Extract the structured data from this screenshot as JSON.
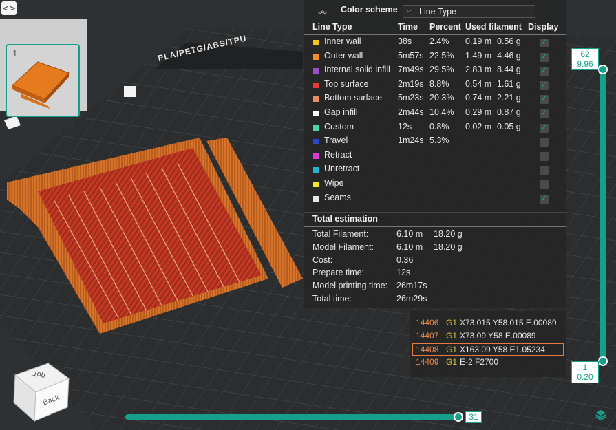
{
  "toolbar": {
    "toggle_icon": "<>"
  },
  "plate": {
    "number": "1",
    "bed_label": "PLA/PETG/ABS/TPU"
  },
  "view_cube": {
    "top": "Top",
    "back": "Back"
  },
  "color_scheme": {
    "label": "Color scheme",
    "value": "Line Type"
  },
  "table": {
    "headers": {
      "line_type": "Line Type",
      "time": "Time",
      "percent": "Percent",
      "used_filament": "Used filament",
      "display": "Display"
    },
    "rows": [
      {
        "name": "Inner wall",
        "color": "#f5c518",
        "time": "38s",
        "percent": "2.4%",
        "length": "0.19 m",
        "weight": "0.56 g",
        "display": true
      },
      {
        "name": "Outer wall",
        "color": "#f58c2a",
        "time": "5m57s",
        "percent": "22.5%",
        "length": "1.49 m",
        "weight": "4.46 g",
        "display": true
      },
      {
        "name": "Internal solid infill",
        "color": "#9a4fd0",
        "time": "7m49s",
        "percent": "29.5%",
        "length": "2.83 m",
        "weight": "8.44 g",
        "display": true
      },
      {
        "name": "Top surface",
        "color": "#e8393a",
        "time": "2m19s",
        "percent": "8.8%",
        "length": "0.54 m",
        "weight": "1.61 g",
        "display": true
      },
      {
        "name": "Bottom surface",
        "color": "#f08a60",
        "time": "5m23s",
        "percent": "20.3%",
        "length": "0.74 m",
        "weight": "2.21 g",
        "display": true
      },
      {
        "name": "Gap infill",
        "color": "#ffffff",
        "time": "2m44s",
        "percent": "10.4%",
        "length": "0.29 m",
        "weight": "0.87 g",
        "display": true
      },
      {
        "name": "Custom",
        "color": "#4cd4a0",
        "time": "12s",
        "percent": "0.8%",
        "length": "0.02 m",
        "weight": "0.05 g",
        "display": true
      },
      {
        "name": "Travel",
        "color": "#2e46c8",
        "time": "1m24s",
        "percent": "5.3%",
        "length": "",
        "weight": "",
        "display": false
      },
      {
        "name": "Retract",
        "color": "#d43ad4",
        "time": "",
        "percent": "",
        "length": "",
        "weight": "",
        "display": false
      },
      {
        "name": "Unretract",
        "color": "#27b0d0",
        "time": "",
        "percent": "",
        "length": "",
        "weight": "",
        "display": false
      },
      {
        "name": "Wipe",
        "color": "#f5e81c",
        "time": "",
        "percent": "",
        "length": "",
        "weight": "",
        "display": false
      },
      {
        "name": "Seams",
        "color": "#e6e6e6",
        "time": "",
        "percent": "",
        "length": "",
        "weight": "",
        "display": true
      }
    ]
  },
  "total": {
    "title": "Total estimation",
    "rows": [
      {
        "label": "Total Filament:",
        "v1": "6.10 m",
        "v2": "18.20 g"
      },
      {
        "label": "Model Filament:",
        "v1": "6.10 m",
        "v2": "18.20 g"
      },
      {
        "label": "Cost:",
        "v1": "0.36",
        "v2": ""
      },
      {
        "label": "Prepare time:",
        "v1": "12s",
        "v2": ""
      },
      {
        "label": "Model printing time:",
        "v1": "26m17s",
        "v2": ""
      },
      {
        "label": "Total time:",
        "v1": "26m29s",
        "v2": ""
      }
    ]
  },
  "gcode": [
    {
      "num": "14406",
      "cmd": "G1",
      "args": "X73.015 Y58.015 E.00089",
      "selected": false
    },
    {
      "num": "14407",
      "cmd": "G1",
      "args": "X73.09 Y58 E.00089",
      "selected": false
    },
    {
      "num": "14408",
      "cmd": "G1",
      "args": "X163.09 Y58 E1.05234",
      "selected": true
    },
    {
      "num": "14409",
      "cmd": "G1",
      "args": "E-2 F2700",
      "selected": false
    }
  ],
  "layer_slider": {
    "top_layer": "62",
    "top_height": "9.96",
    "bottom_layer": "1",
    "bottom_height": "0.20"
  },
  "move_slider": {
    "value": "31"
  },
  "icons": {
    "collapse": "double-chevron-up-icon",
    "layers": "layers-icon",
    "toggle": "code-brackets-icon"
  }
}
